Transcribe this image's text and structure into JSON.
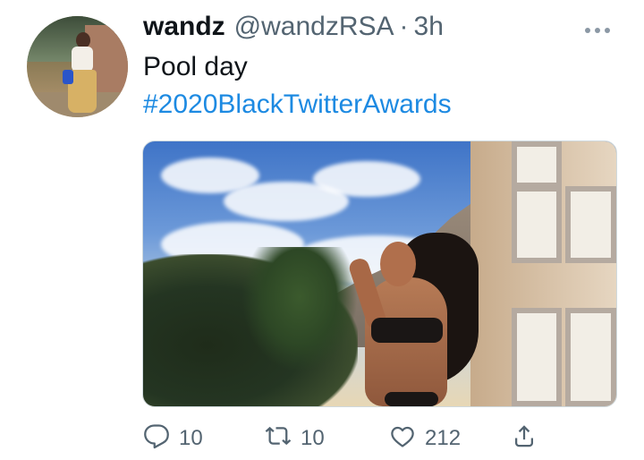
{
  "tweet": {
    "user": {
      "display_name": "wandz",
      "handle": "@wandzRSA",
      "time": "3h"
    },
    "text": "Pool day",
    "hashtag": "#2020BlackTwitterAwards",
    "metrics": {
      "replies": "10",
      "retweets": "10",
      "likes": "212"
    }
  },
  "icons": {
    "more": "more-icon",
    "reply": "reply-icon",
    "retweet": "retweet-icon",
    "like": "heart-icon",
    "share": "share-icon"
  },
  "colors": {
    "text": "#0f1419",
    "secondary": "#536471",
    "link": "#1d8ae2"
  }
}
